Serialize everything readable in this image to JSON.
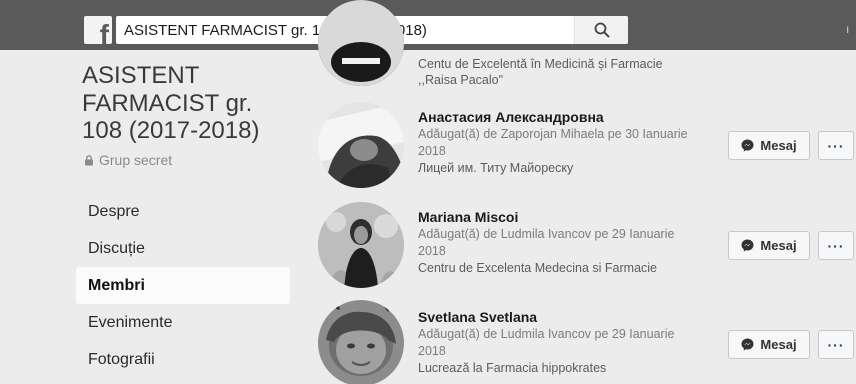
{
  "search": {
    "value": "ASISTENT FARMACIST gr. 108  (2017-2018)"
  },
  "group": {
    "title": "ASISTENT FARMACIST gr. 108 (2017-2018)",
    "privacy": "Grup secret"
  },
  "nav": {
    "items": [
      {
        "label": "Despre",
        "active": false
      },
      {
        "label": "Discuție",
        "active": false
      },
      {
        "label": "Membri",
        "active": true
      },
      {
        "label": "Evenimente",
        "active": false
      },
      {
        "label": "Fotografii",
        "active": false
      }
    ]
  },
  "members": [
    {
      "name": "",
      "added": "",
      "year": "",
      "work": "Centu de Excelentă în Medicină și Farmacie",
      "work2": ",,Raisa Pacalo\""
    },
    {
      "name": "Анастасия Александровна",
      "added": "Adăugat(ă) de Zaporojan Mihaela pe 30 Ianuarie",
      "year": "2018",
      "work": "Лицей им. Титу Майореску"
    },
    {
      "name": "Mariana Miscoi",
      "added": "Adăugat(ă) de Ludmila Ivancov pe 29 Ianuarie",
      "year": "2018",
      "work": "Centru de Excelenta Medecina si Farmacie"
    },
    {
      "name": "Svetlana Svetlana",
      "added": "Adăugat(ă) de Ludmila Ivancov pe 29 Ianuarie",
      "year": "2018",
      "work": "Lucrează la Farmacia hippokrates"
    }
  ],
  "buttons": {
    "message": "Mesaj",
    "more": "···"
  },
  "icons": {
    "logo": "f",
    "search": "search-icon",
    "lock": "lock-icon",
    "messenger": "messenger-icon"
  },
  "colors": {
    "topbar": "#5a5a5a",
    "page_bg": "#ececec",
    "active_nav_bg": "#fbfbfb"
  }
}
